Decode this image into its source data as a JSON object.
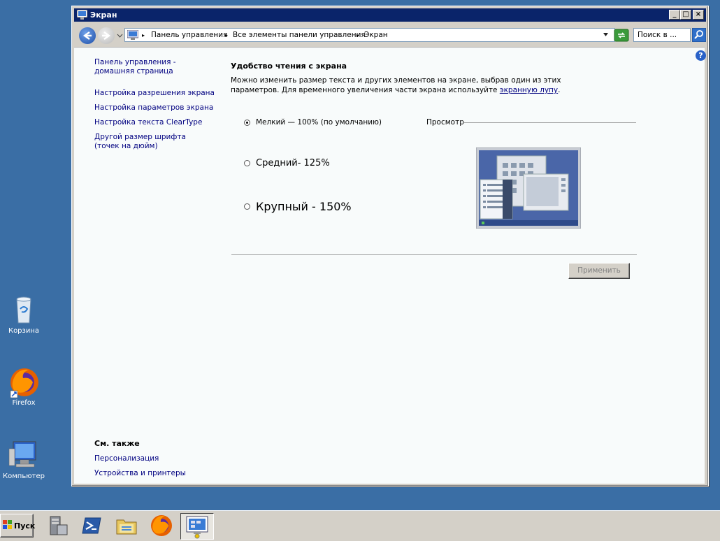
{
  "desktop": {
    "icons": [
      {
        "label": "Корзина"
      },
      {
        "label": "Firefox"
      },
      {
        "label": "Компьютер"
      }
    ]
  },
  "window": {
    "title": "Экран",
    "controls": {
      "minimize": "_",
      "maximize": "□",
      "close": "×"
    }
  },
  "address": {
    "crumbs": [
      "Панель управления",
      "Все элементы панели управления",
      "Экран"
    ],
    "search_placeholder": "Поиск в ..."
  },
  "sidebar": {
    "home_link": "Панель управления - домашняя страница",
    "links": [
      "Настройка разрешения экрана",
      "Настройка параметров экрана",
      "Настройка текста ClearType",
      "Другой размер шрифта (точек на дюйм)"
    ],
    "see_also_title": "См. также",
    "see_also": [
      "Персонализация",
      "Устройства и принтеры"
    ]
  },
  "main": {
    "title": "Удобство чтения с экрана",
    "desc_part1": "Можно изменить размер текста и других элементов на экране, выбрав один из этих параметров. Для временного увеличения части экрана используйте ",
    "desc_link": "экранную лупу",
    "desc_end": ".",
    "options": [
      {
        "label": "Мелкий — 100% (по умолчанию)",
        "selected": true
      },
      {
        "label": "Средний- 125%",
        "selected": false
      },
      {
        "label": "Крупный - 150%",
        "selected": false
      }
    ],
    "preview_label": "Просмотр",
    "apply_label": "Применить",
    "help": "?"
  },
  "taskbar": {
    "start_label": "Пуск"
  }
}
